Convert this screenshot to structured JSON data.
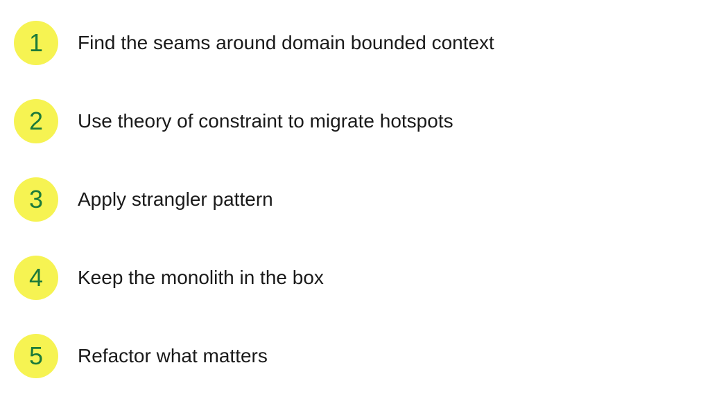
{
  "items": [
    {
      "number": "1",
      "label": "Find the seams around domain bounded context"
    },
    {
      "number": "2",
      "label": "Use theory of constraint to migrate hotspots"
    },
    {
      "number": "3",
      "label": "Apply strangler pattern"
    },
    {
      "number": "4",
      "label": "Keep the monolith in the box"
    },
    {
      "number": "5",
      "label": "Refactor what matters"
    }
  ],
  "colors": {
    "badge_bg": "#f6f352",
    "number_color": "#1c7a3a",
    "text_color": "#1a1a1a"
  }
}
